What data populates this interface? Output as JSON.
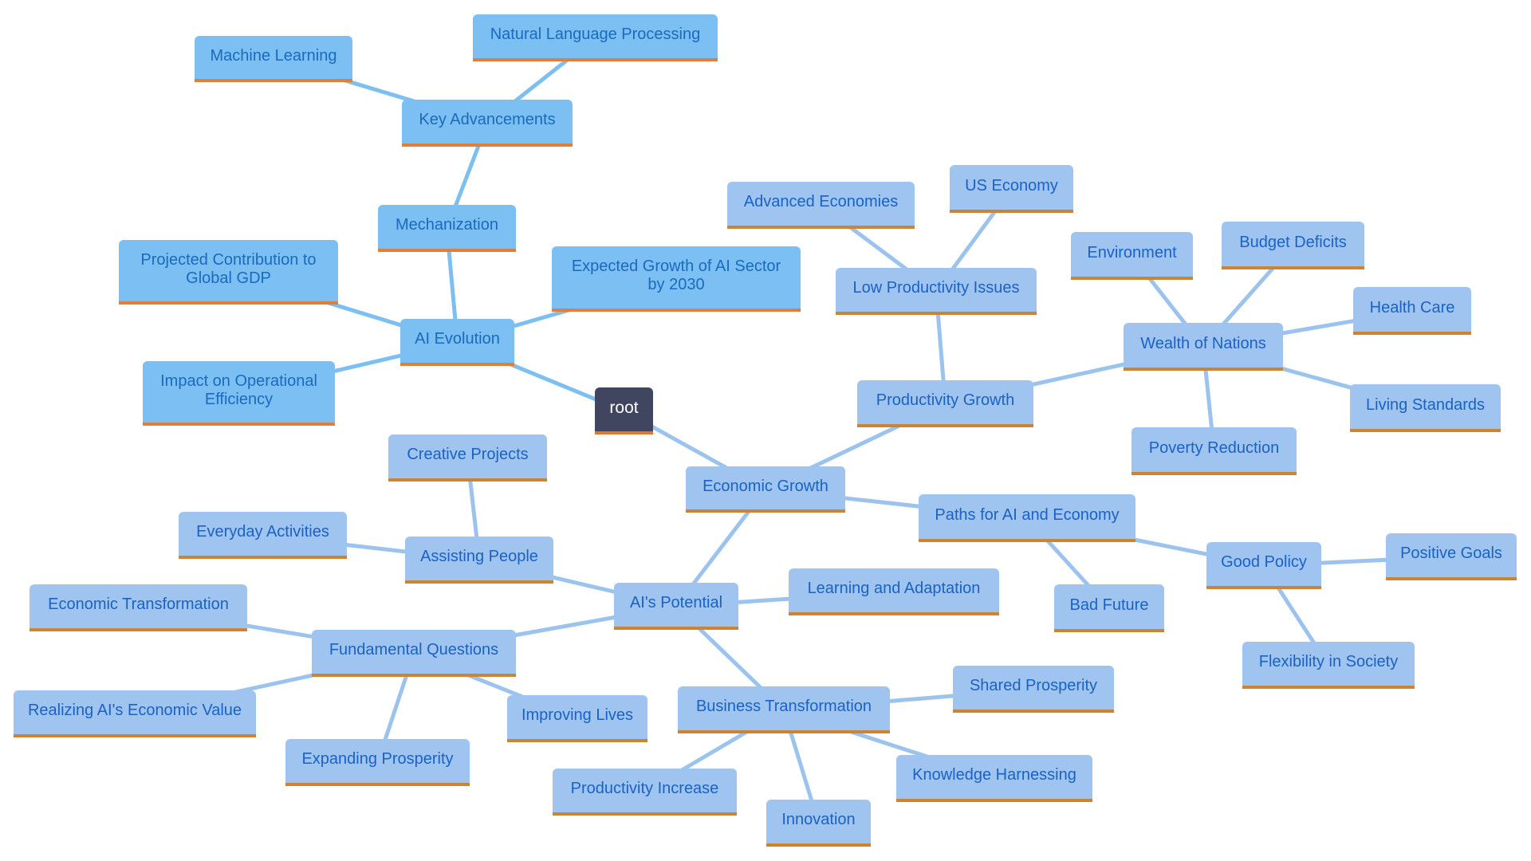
{
  "diagram": {
    "type": "mindmap",
    "colors": {
      "root_fill": "#414660",
      "root_text": "#ffffff",
      "ai_branch_fill": "#7cbff2",
      "ai_branch_text": "#1a6abf",
      "econ_branch_fill": "#9fc4f0",
      "econ_branch_text": "#1a62c4",
      "accent_underline": "#cc8433",
      "ai_edge": "#7cbff0",
      "econ_edge": "#9cc3ee"
    },
    "nodes": [
      {
        "id": "root",
        "label": "root",
        "parent": null,
        "branch": "root"
      },
      {
        "id": "ai-evolution",
        "label": "AI Evolution",
        "parent": "root",
        "branch": "ai"
      },
      {
        "id": "mechanization",
        "label": "Mechanization",
        "parent": "ai-evolution",
        "branch": "ai"
      },
      {
        "id": "key-advancements",
        "label": "Key Advancements",
        "parent": "mechanization",
        "branch": "ai"
      },
      {
        "id": "machine-learning",
        "label": "Machine Learning",
        "parent": "key-advancements",
        "branch": "ai"
      },
      {
        "id": "nlp",
        "label": "Natural Language Processing",
        "parent": "key-advancements",
        "branch": "ai"
      },
      {
        "id": "projected-contribution",
        "label": "Projected Contribution to Global GDP",
        "parent": "ai-evolution",
        "branch": "ai"
      },
      {
        "id": "impact-operational",
        "label": "Impact on Operational Efficiency",
        "parent": "ai-evolution",
        "branch": "ai"
      },
      {
        "id": "expected-growth",
        "label": "Expected Growth of AI Sector by 2030",
        "parent": "ai-evolution",
        "branch": "ai"
      },
      {
        "id": "economic-growth",
        "label": "Economic Growth",
        "parent": "root",
        "branch": "econ"
      },
      {
        "id": "productivity-growth",
        "label": "Productivity Growth",
        "parent": "economic-growth",
        "branch": "econ"
      },
      {
        "id": "low-productivity",
        "label": "Low Productivity Issues",
        "parent": "productivity-growth",
        "branch": "econ"
      },
      {
        "id": "advanced-economies",
        "label": "Advanced Economies",
        "parent": "low-productivity",
        "branch": "econ"
      },
      {
        "id": "us-economy",
        "label": "US Economy",
        "parent": "low-productivity",
        "branch": "econ"
      },
      {
        "id": "wealth-of-nations",
        "label": "Wealth of Nations",
        "parent": "productivity-growth",
        "branch": "econ"
      },
      {
        "id": "environment",
        "label": "Environment",
        "parent": "wealth-of-nations",
        "branch": "econ"
      },
      {
        "id": "budget-deficits",
        "label": "Budget Deficits",
        "parent": "wealth-of-nations",
        "branch": "econ"
      },
      {
        "id": "health-care",
        "label": "Health Care",
        "parent": "wealth-of-nations",
        "branch": "econ"
      },
      {
        "id": "living-standards",
        "label": "Living Standards",
        "parent": "wealth-of-nations",
        "branch": "econ"
      },
      {
        "id": "poverty-reduction",
        "label": "Poverty Reduction",
        "parent": "wealth-of-nations",
        "branch": "econ"
      },
      {
        "id": "paths-ai-economy",
        "label": "Paths for AI and Economy",
        "parent": "economic-growth",
        "branch": "econ"
      },
      {
        "id": "good-policy",
        "label": "Good Policy",
        "parent": "paths-ai-economy",
        "branch": "econ"
      },
      {
        "id": "positive-goals",
        "label": "Positive Goals",
        "parent": "good-policy",
        "branch": "econ"
      },
      {
        "id": "flexibility-society",
        "label": "Flexibility in Society",
        "parent": "good-policy",
        "branch": "econ"
      },
      {
        "id": "bad-future",
        "label": "Bad Future",
        "parent": "paths-ai-economy",
        "branch": "econ"
      },
      {
        "id": "ais-potential",
        "label": "AI's Potential",
        "parent": "economic-growth",
        "branch": "econ"
      },
      {
        "id": "learning-adaptation",
        "label": "Learning and Adaptation",
        "parent": "ais-potential",
        "branch": "econ"
      },
      {
        "id": "assisting-people",
        "label": "Assisting People",
        "parent": "ais-potential",
        "branch": "econ"
      },
      {
        "id": "creative-projects",
        "label": "Creative Projects",
        "parent": "assisting-people",
        "branch": "econ"
      },
      {
        "id": "everyday-activities",
        "label": "Everyday Activities",
        "parent": "assisting-people",
        "branch": "econ"
      },
      {
        "id": "fundamental-questions",
        "label": "Fundamental Questions",
        "parent": "ais-potential",
        "branch": "econ"
      },
      {
        "id": "economic-transformation",
        "label": "Economic Transformation",
        "parent": "fundamental-questions",
        "branch": "econ"
      },
      {
        "id": "realizing-value",
        "label": "Realizing AI's Economic Value",
        "parent": "fundamental-questions",
        "branch": "econ"
      },
      {
        "id": "expanding-prosperity",
        "label": "Expanding Prosperity",
        "parent": "fundamental-questions",
        "branch": "econ"
      },
      {
        "id": "improving-lives",
        "label": "Improving Lives",
        "parent": "fundamental-questions",
        "branch": "econ"
      },
      {
        "id": "business-transformation",
        "label": "Business Transformation",
        "parent": "ais-potential",
        "branch": "econ"
      },
      {
        "id": "shared-prosperity",
        "label": "Shared Prosperity",
        "parent": "business-transformation",
        "branch": "econ"
      },
      {
        "id": "knowledge-harnessing",
        "label": "Knowledge Harnessing",
        "parent": "business-transformation",
        "branch": "econ"
      },
      {
        "id": "productivity-increase",
        "label": "Productivity Increase",
        "parent": "business-transformation",
        "branch": "econ"
      },
      {
        "id": "innovation",
        "label": "Innovation",
        "parent": "business-transformation",
        "branch": "econ"
      }
    ]
  }
}
